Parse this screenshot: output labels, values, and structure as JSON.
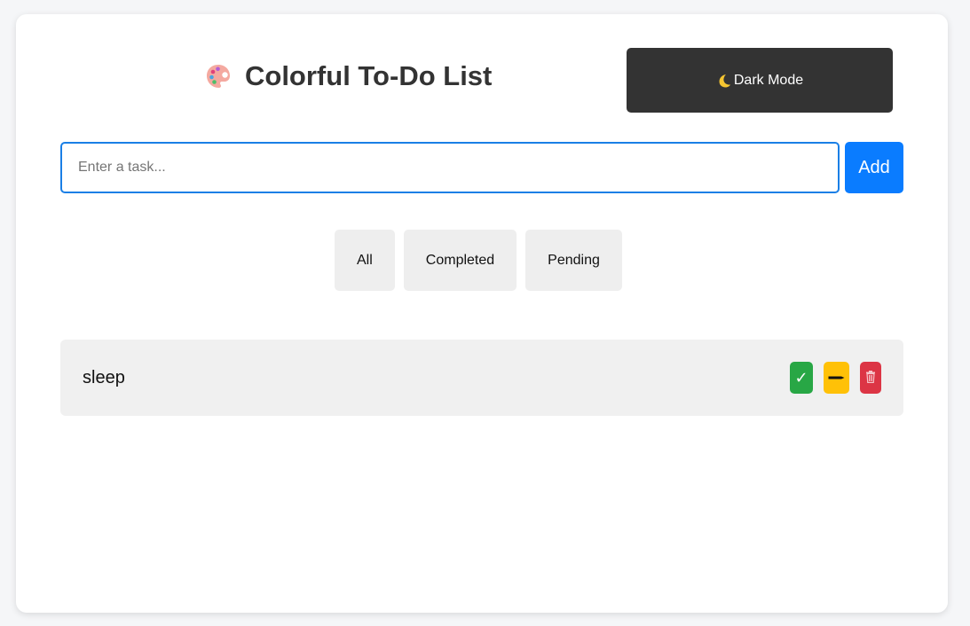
{
  "header": {
    "title": "Colorful To-Do List",
    "title_icon": "palette-icon",
    "theme_toggle_label": "Dark Mode",
    "theme_toggle_icon": "moon-icon"
  },
  "input": {
    "placeholder": "Enter a task...",
    "value": "",
    "add_label": "Add"
  },
  "filters": [
    {
      "label": "All"
    },
    {
      "label": "Completed"
    },
    {
      "label": "Pending"
    }
  ],
  "tasks": [
    {
      "text": "sleep",
      "actions": {
        "complete_icon": "✓",
        "edit_icon": "pencil-icon",
        "delete_icon": "trash-icon"
      }
    }
  ],
  "colors": {
    "accent": "#0a7cff",
    "dark_button": "#333333",
    "complete": "#28a745",
    "edit": "#ffc107",
    "delete": "#dc3545"
  }
}
